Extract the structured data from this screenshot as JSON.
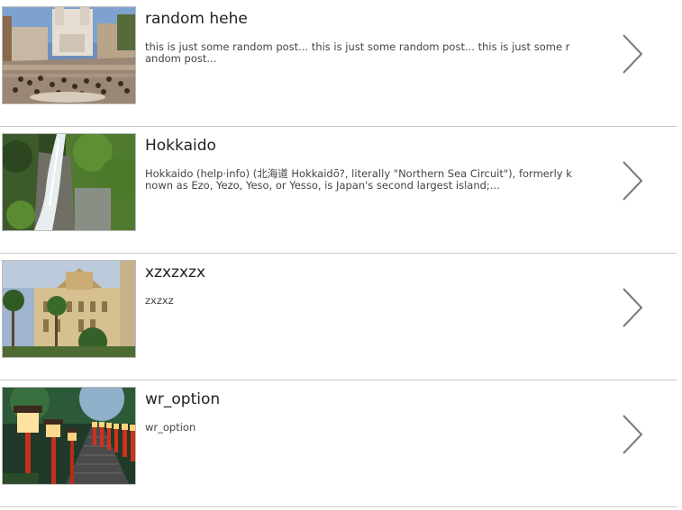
{
  "posts": [
    {
      "title": "random hehe",
      "excerpt": "this is just some random post... this is just some random post... this is just some random post...",
      "image": "spanish-steps-photo",
      "chevron_icon": "chevron-right-icon"
    },
    {
      "title": "Hokkaido",
      "excerpt": "Hokkaido (help·info) (北海道 Hokkaidō?, literally \"Northern Sea Circuit\"), formerly known as Ezo, Yezo, Yeso, or Yesso, is Japan's second largest island;...",
      "image": "waterfall-photo",
      "chevron_icon": "chevron-right-icon"
    },
    {
      "title": "xzxzxzx",
      "excerpt": "zxzxz",
      "image": "building-palms-photo",
      "chevron_icon": "chevron-right-icon"
    },
    {
      "title": "wr_option",
      "excerpt": "wr_option",
      "image": "lanterns-photo",
      "chevron_icon": "chevron-right-icon"
    }
  ],
  "colors": {
    "divider": "#c8c8c8",
    "chevron": "#7a7a7a",
    "title": "#222222",
    "text": "#444444"
  }
}
